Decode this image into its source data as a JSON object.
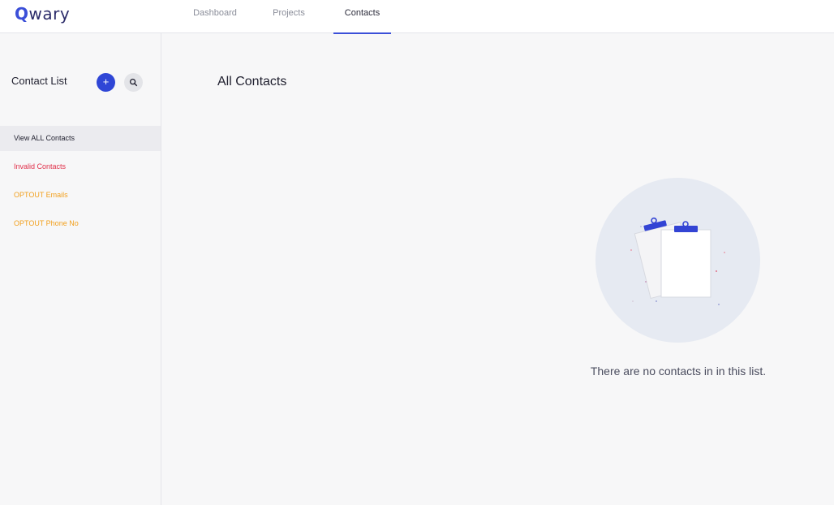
{
  "app": {
    "logo_letter": "Q",
    "logo_rest": "wary"
  },
  "nav": {
    "tabs": [
      {
        "label": "Dashboard"
      },
      {
        "label": "Projects"
      },
      {
        "label": "Contacts",
        "active": true
      }
    ]
  },
  "sidebar": {
    "title": "Contact List",
    "add_label": "+",
    "items": [
      {
        "label": "View ALL Contacts",
        "selected": true
      },
      {
        "label": "Invalid Contacts"
      },
      {
        "label": "OPTOUT Emails"
      },
      {
        "label": "OPTOUT Phone No"
      }
    ]
  },
  "main": {
    "title": "All Contacts",
    "empty_message": "There are no contacts in in this list."
  },
  "colors": {
    "brand": "#3b4fd8",
    "invalid": "#e0304a",
    "optout": "#f2a01e",
    "empty_circle": "#e6eaf2"
  },
  "icons": {
    "add": "plus-icon",
    "search": "search-icon",
    "empty": "clipboard-icon"
  }
}
